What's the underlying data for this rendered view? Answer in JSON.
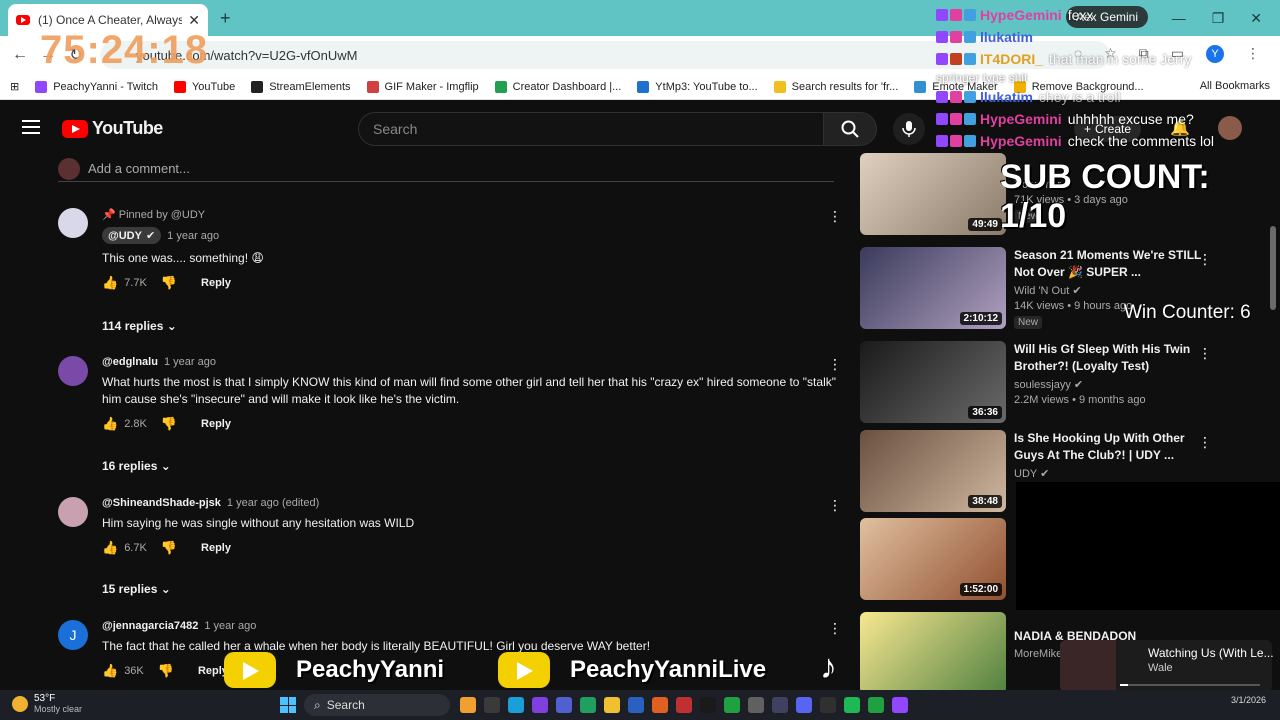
{
  "browser": {
    "tab_title": "(1) Once A Cheater, Always A C",
    "tab_close": "✕",
    "new_tab": "+",
    "profile_pill": "Aex Gemini",
    "url": "youtube.com/watch?v=U2G-vfOnUwM",
    "bookmarks": [
      {
        "label": "PeachyYanni - Twitch",
        "color": "#9146ff"
      },
      {
        "label": "YouTube",
        "color": "#ff0000"
      },
      {
        "label": "StreamElements",
        "color": "#222222"
      },
      {
        "label": "GIF Maker - Imgflip",
        "color": "#d04040"
      },
      {
        "label": "Creator Dashboard |...",
        "color": "#20a050"
      },
      {
        "label": "YtMp3: YouTube to...",
        "color": "#2070d0"
      },
      {
        "label": "Search results for 'fr...",
        "color": "#f0c020"
      },
      {
        "label": "Emote Maker",
        "color": "#3090d0"
      },
      {
        "label": "Remove Background...",
        "color": "#f0b000"
      }
    ],
    "all_bookmarks": "All Bookmarks"
  },
  "youtube": {
    "logo_text": "YouTube",
    "search_placeholder": "Search",
    "create_label": "Create",
    "add_comment_placeholder": "Add a comment..."
  },
  "comments": [
    {
      "pinned": "Pinned by @UDY",
      "handle": "@UDY",
      "verified": true,
      "time": "1 year ago",
      "text": "This one was.... something! 😩",
      "likes": "7.7K",
      "reply_label": "Reply",
      "replies": "114 replies",
      "avatar_color": "#d8d8e8"
    },
    {
      "handle": "@edglnalu",
      "time": "1 year ago",
      "text": "What hurts the most is that I simply KNOW this kind of man will find some other girl and tell her that his \"crazy ex\" hired someone to \"stalk\" him cause she's \"insecure\" and will make it look like he's the victim.",
      "likes": "2.8K",
      "reply_label": "Reply",
      "replies": "16 replies",
      "avatar_color": "#7a4aa8"
    },
    {
      "handle": "@ShineandShade-pjsk",
      "time": "1 year ago (edited)",
      "text": "Him saying he was single without any hesitation was WILD",
      "likes": "6.7K",
      "reply_label": "Reply",
      "replies": "15 replies",
      "avatar_color": "#c8a0b0"
    },
    {
      "handle": "@jennagarcia7482",
      "time": "1 year ago",
      "text": "The fact that he called her a whale when her body is literally BEAUTIFUL! Girl you deserve WAY better!",
      "likes": "36K",
      "reply_label": "Reply",
      "avatar_letter": "J",
      "avatar_color": "#1a6fd8"
    }
  ],
  "sidebar_videos": [
    {
      "title": "",
      "channel": "Noluvmar",
      "stats": "71K views • 3 days ago",
      "badge": "New",
      "duration": "49:49",
      "thumb_color": "#c8b8a8"
    },
    {
      "title": "Season 21 Moments We're STILL Not Over 🎉 SUPER ...",
      "channel": "Wild 'N Out",
      "stats": "14K views • 9 hours ago",
      "badge": "New",
      "duration": "2:10:12",
      "thumb_color": "#4a4a6a"
    },
    {
      "title": "Will His Gf Sleep With His Twin Brother?! (Loyalty Test)",
      "channel": "soulessjayy",
      "stats": "2.2M views • 9 months ago",
      "duration": "36:36",
      "thumb_color": "#2a2a2a"
    },
    {
      "title": "Is She Hooking Up With Other Guys At The Club?! | UDY ...",
      "channel": "UDY",
      "stats": "",
      "duration": "38:48",
      "thumb_color": "#8a7060"
    },
    {
      "title": "",
      "channel": "",
      "stats": "",
      "duration": "1:52:00",
      "thumb_color": "#c89070"
    },
    {
      "title": "NADIA & BENDADON",
      "channel": "MoreMike",
      "stats": "",
      "duration": "",
      "thumb_color": "#f0e070"
    }
  ],
  "overlay": {
    "timer": "75:24:18",
    "sub_count": "SUB COUNT: 1/10",
    "win_counter": "Win Counter: 6",
    "brand_1": "PeachyYanni",
    "brand_2": "PeachyYanniLive",
    "chat": [
      {
        "user": "HypeGemini",
        "msg": "fexx",
        "color": "#e040a0"
      },
      {
        "user": "llukatim",
        "msg": "",
        "color": "#4060e0"
      },
      {
        "user": "IT4DORI_",
        "msg": "that man in some Jerry",
        "color": "#e0a020"
      },
      {
        "user": "",
        "msg": "springer type shit",
        "color": "#ffffff"
      },
      {
        "user": "llukatim",
        "msg": "chey is a troll",
        "color": "#4060e0"
      },
      {
        "user": "HypeGemini",
        "msg": "uhhhhh excuse me?",
        "color": "#e040a0"
      },
      {
        "user": "HypeGemini",
        "msg": "check the comments lol",
        "color": "#e040a0"
      }
    ],
    "music_title": "Watching Us (With Le...",
    "music_artist": "Wale"
  },
  "taskbar": {
    "temp": "53°F",
    "condition": "Mostly clear",
    "search": "Search",
    "date": "3/1/2026"
  }
}
